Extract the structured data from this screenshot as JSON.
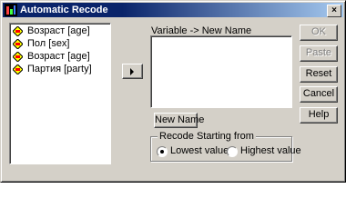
{
  "window": {
    "title": "Automatic Recode",
    "close_glyph": "×"
  },
  "variables": {
    "items": [
      {
        "label": "Возраст [age]",
        "selected": false
      },
      {
        "label": "Пол [sex]",
        "selected": false
      },
      {
        "label": "Возраст [age]",
        "selected": false
      },
      {
        "label": "Партия [party]",
        "selected": false
      }
    ]
  },
  "move_button": {
    "icon": "right-arrow-icon"
  },
  "target": {
    "header": "Variable -> New Name"
  },
  "buttons": {
    "ok": "OK",
    "paste": "Paste",
    "reset": "Reset",
    "cancel": "Cancel",
    "help": "Help"
  },
  "new_name_button": "New Name",
  "recode_group": {
    "title": "Recode Starting from",
    "lowest_label": "Lowest value",
    "highest_label": "Highest value",
    "selected": "lowest"
  },
  "colors": {
    "titlebar_start": "#0a246a",
    "titlebar_end": "#a6caf0",
    "dialog_bg": "#d4d0c8",
    "selection": "#0a246a"
  }
}
